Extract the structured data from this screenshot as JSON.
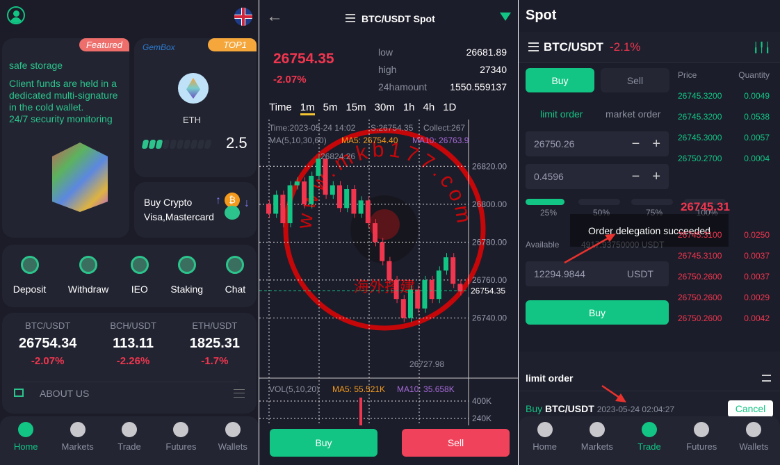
{
  "left": {
    "featured_badge": "Featured",
    "storage_title": "safe storage",
    "storage_text": [
      "Client funds are held in a",
      "dedicated multi-signature",
      "in the cold wallet.",
      "24/7 security monitoring"
    ],
    "gembox": "GemBox",
    "top_badge": "TOP1",
    "coin": "ETH",
    "score": "2.5",
    "score_fill": 0.3,
    "buy_crypto": "Buy Crypto",
    "payment": "Visa,Mastercard",
    "actions": [
      {
        "label": "Deposit",
        "icon": "rocket-icon"
      },
      {
        "label": "Withdraw",
        "icon": "wallet-icon"
      },
      {
        "label": "IEO",
        "icon": "orbit-icon"
      },
      {
        "label": "Staking",
        "icon": "hammer-icon"
      },
      {
        "label": "Chat",
        "icon": "headset-icon"
      }
    ],
    "tickers": [
      {
        "pair": "BTC/USDT",
        "price": "26754.34",
        "change": "-2.07%"
      },
      {
        "pair": "BCH/USDT",
        "price": "113.11",
        "change": "-2.26%"
      },
      {
        "pair": "ETH/USDT",
        "price": "1825.31",
        "change": "-1.7%"
      }
    ],
    "about": "ABOUT US"
  },
  "nav": [
    {
      "label": "Home",
      "icon": "home-icon"
    },
    {
      "label": "Markets",
      "icon": "bar-chart-icon"
    },
    {
      "label": "Trade",
      "icon": "trade-icon"
    },
    {
      "label": "Futures",
      "icon": "trend-icon"
    },
    {
      "label": "Wallets",
      "icon": "pie-icon"
    }
  ],
  "mid": {
    "title": "BTC/USDT Spot",
    "price": "26754.35",
    "change": "-2.07%",
    "stats": [
      {
        "k": "low",
        "v": "26681.89"
      },
      {
        "k": "high",
        "v": "27340"
      },
      {
        "k": "24hamount",
        "v": "1550.559137"
      }
    ],
    "timeframes": [
      "Time",
      "1m",
      "5m",
      "15m",
      "30m",
      "1h",
      "4h",
      "1D"
    ],
    "active_tf": "1m",
    "info1": "Time:2023-05-24 14:02",
    "info2": "S:26754.35",
    "info3": "Collect:267",
    "ma_label": "MA(5,10,30,60)",
    "ma5": "MA5: 26754.40",
    "ma10": "MA10: 26763.9",
    "max_label": "26824.26",
    "min_label": "26727.98",
    "last_tag": "26754.35",
    "price_axis": [
      "26820.00",
      "26800.00",
      "26780.00",
      "26760.00",
      "26740.00"
    ],
    "vol_label": "VOL(5,10,20)",
    "vol_ma5": "MA5: 55.521K",
    "vol_ma10": "MA10: 35.658K",
    "vol_axis": [
      "400K",
      "240K"
    ],
    "buy": "Buy",
    "sell": "Sell",
    "candles": [
      [
        26800,
        26795
      ],
      [
        26795,
        26805
      ],
      [
        26805,
        26790
      ],
      [
        26790,
        26810
      ],
      [
        26810,
        26812
      ],
      [
        26812,
        26800
      ],
      [
        26800,
        26815
      ],
      [
        26815,
        26824
      ],
      [
        26824,
        26805
      ],
      [
        26805,
        26810
      ],
      [
        26810,
        26798
      ],
      [
        26798,
        26808
      ],
      [
        26808,
        26795
      ],
      [
        26795,
        26802
      ],
      [
        26802,
        26790
      ],
      [
        26790,
        26780
      ],
      [
        26780,
        26770
      ],
      [
        26770,
        26760
      ],
      [
        26760,
        26750
      ],
      [
        26750,
        26740
      ],
      [
        26740,
        26755
      ],
      [
        26755,
        26745
      ],
      [
        26745,
        26760
      ],
      [
        26760,
        26750
      ],
      [
        26750,
        26765
      ],
      [
        26765,
        26772
      ],
      [
        26772,
        26758
      ],
      [
        26758,
        26754
      ]
    ]
  },
  "watermark": {
    "url": "www.mkb177.com",
    "cn": "海外搭建"
  },
  "right": {
    "title": "Spot",
    "pair": "BTC/USDT",
    "change": "-2.1%",
    "buy_tab": "Buy",
    "sell_tab": "Sell",
    "limit": "limit order",
    "market": "market order",
    "price_input": "26750.26",
    "qty_input": "0.4596",
    "percents": [
      "25%",
      "50%",
      "75%",
      "100%"
    ],
    "percent_selected": "25%",
    "available_label": "Available",
    "available_value": "4917.93750000 USDT",
    "amount": "12294.9844",
    "amount_unit": "USDT",
    "buy_btn": "Buy",
    "ob_price": "Price",
    "ob_qty": "Quantity",
    "asks": [
      {
        "p": "26745.3200",
        "q": "0.0049"
      },
      {
        "p": "26745.3200",
        "q": "0.0538"
      },
      {
        "p": "26745.3000",
        "q": "0.0057"
      },
      {
        "p": "26750.2700",
        "q": "0.0004"
      }
    ],
    "mid_price": "26745.31",
    "bids": [
      {
        "p": "26745.3100",
        "q": "0.0250"
      },
      {
        "p": "26745.3100",
        "q": "0.0037"
      },
      {
        "p": "26750.2600",
        "q": "0.0037"
      },
      {
        "p": "26750.2600",
        "q": "0.0029"
      },
      {
        "p": "26750.2600",
        "q": "0.0042"
      }
    ],
    "toast": "Order delegation succeeded",
    "orders_title": "limit order",
    "order_side": "Buy",
    "order_pair": "BTC/USDT",
    "order_time": "2023-05-24 02:04:27",
    "cancel": "Cancel"
  },
  "colors": {
    "green": "#12c584",
    "red": "#f0364f",
    "bg": "#1b1c28",
    "card": "#222431"
  }
}
